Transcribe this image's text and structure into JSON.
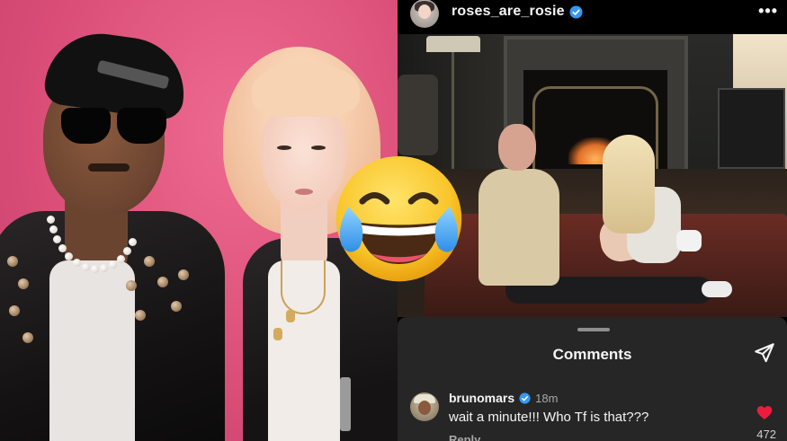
{
  "post": {
    "username": "roses_are_rosie",
    "verified": true,
    "more_icon": "more-horizontal-icon"
  },
  "comments_sheet": {
    "title": "Comments",
    "share_icon": "send-icon"
  },
  "comment": {
    "username": "brunomars",
    "verified": true,
    "time": "18m",
    "text": "wait a minute!!! Who Tf is that???",
    "reply_label": "Reply",
    "like_icon": "heart-filled-icon",
    "like_count": "472"
  },
  "overlay": {
    "emoji": "face-with-tears-of-joy-icon"
  },
  "colors": {
    "left_background": "#e0577f",
    "verified_blue": "#3897f0",
    "heart_red": "#ed1c3f",
    "sheet_background": "#262626"
  }
}
